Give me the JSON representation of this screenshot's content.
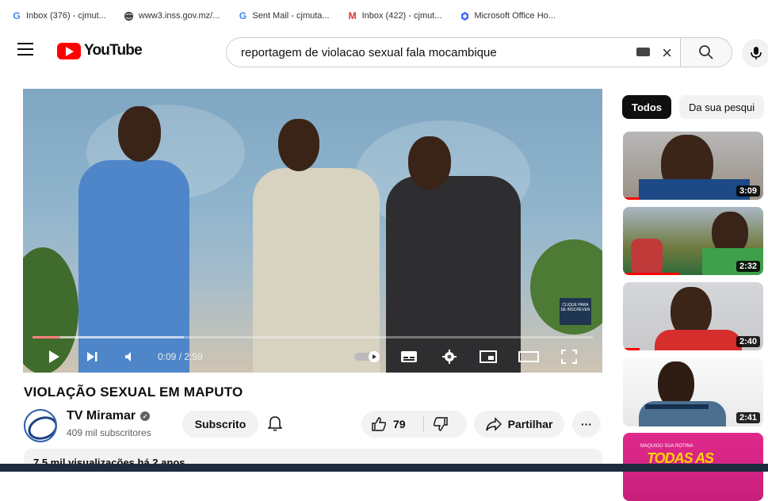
{
  "bookmarks": [
    {
      "icon": "google-icon",
      "label": "Inbox (376) - cjmut...",
      "color": "#4285f4"
    },
    {
      "icon": "globe-icon",
      "label": "www3.inss.gov.mz/...",
      "color": "#333333"
    },
    {
      "icon": "google-icon",
      "label": "Sent Mail - cjmuta...",
      "color": "#4285f4"
    },
    {
      "icon": "gmail-icon",
      "label": "Inbox (422) - cjmut...",
      "color": "#d93025"
    },
    {
      "icon": "office-icon",
      "label": "Microsoft Office Ho...",
      "color": "#4a6cf7"
    }
  ],
  "header": {
    "logo_text": "YouTube",
    "search_value": "reportagem de violacao sexual fala mocambique"
  },
  "player": {
    "time": "0:09 / 2:59",
    "progress_fraction": 0.05,
    "loaded_fraction": 0.27,
    "cta_text": "CLIQUE PARA SE INSCREVER"
  },
  "video": {
    "title": "VIOLAÇÃO SEXUAL EM MAPUTO",
    "channel_name": "TV Miramar",
    "subscribers": "409 mil subscritores",
    "subscribe_label": "Subscrito",
    "likes": "79",
    "share_label": "Partilhar",
    "description_preview": "7,5 mil visualizações  há 2 anos"
  },
  "sidebar": {
    "chips": [
      "Todos",
      "Da sua pesqui"
    ],
    "thumbnails": [
      {
        "duration": "3:09"
      },
      {
        "duration": "2:32"
      },
      {
        "duration": "2:40"
      },
      {
        "duration": "2:41"
      },
      {
        "top_text": "MAQUIOU SUA ROTINA",
        "big_text": "TODAS AS"
      }
    ]
  },
  "colors": {
    "brand": "#ff0000",
    "accent_blue": "#2a5da8"
  }
}
